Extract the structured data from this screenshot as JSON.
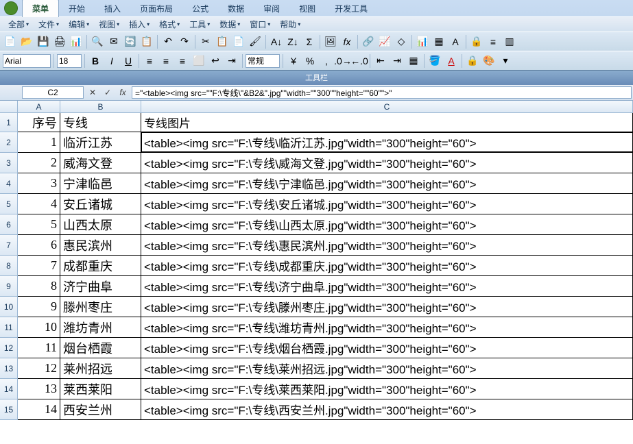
{
  "tabs": {
    "menu": "菜单",
    "start": "开始",
    "insert": "插入",
    "layout": "页面布局",
    "formula": "公式",
    "data": "数据",
    "review": "审阅",
    "view": "视图",
    "dev": "开发工具"
  },
  "menu": {
    "all": "全部",
    "file": "文件",
    "edit": "编辑",
    "view": "视图",
    "insert": "插入",
    "format": "格式",
    "tools": "工具",
    "data": "数据",
    "window": "窗口",
    "help": "帮助"
  },
  "toolbar": {
    "font": "Arial",
    "size": "18",
    "style_normal": "常规",
    "label": "工具栏"
  },
  "formula_bar": {
    "name_box": "C2",
    "fx": "fx",
    "formula": "=\"<table><img src=\"\"F:\\专线\\\"&B2&\".jpg\"\"width=\"\"300\"\"height=\"\"60\"\">\""
  },
  "columns": {
    "A": "A",
    "B": "B",
    "C": "C"
  },
  "header_row": {
    "seq": "序号",
    "line": "专线",
    "pic": "专线图片"
  },
  "rows": [
    {
      "n": "1",
      "seq": "1",
      "line": "临沂江苏",
      "pic": "<table><img src=\"F:\\专线\\临沂江苏.jpg\"width=\"300\"height=\"60\">"
    },
    {
      "n": "2",
      "seq": "2",
      "line": "威海文登",
      "pic": "<table><img src=\"F:\\专线\\威海文登.jpg\"width=\"300\"height=\"60\">"
    },
    {
      "n": "3",
      "seq": "3",
      "line": "宁津临邑",
      "pic": "<table><img src=\"F:\\专线\\宁津临邑.jpg\"width=\"300\"height=\"60\">"
    },
    {
      "n": "4",
      "seq": "4",
      "line": "安丘诸城",
      "pic": "<table><img src=\"F:\\专线\\安丘诸城.jpg\"width=\"300\"height=\"60\">"
    },
    {
      "n": "5",
      "seq": "5",
      "line": "山西太原",
      "pic": "<table><img src=\"F:\\专线\\山西太原.jpg\"width=\"300\"height=\"60\">"
    },
    {
      "n": "6",
      "seq": "6",
      "line": "惠民滨州",
      "pic": "<table><img src=\"F:\\专线\\惠民滨州.jpg\"width=\"300\"height=\"60\">"
    },
    {
      "n": "7",
      "seq": "7",
      "line": "成都重庆",
      "pic": "<table><img src=\"F:\\专线\\成都重庆.jpg\"width=\"300\"height=\"60\">"
    },
    {
      "n": "8",
      "seq": "8",
      "line": "济宁曲阜",
      "pic": "<table><img src=\"F:\\专线\\济宁曲阜.jpg\"width=\"300\"height=\"60\">"
    },
    {
      "n": "9",
      "seq": "9",
      "line": "滕州枣庄",
      "pic": "<table><img src=\"F:\\专线\\滕州枣庄.jpg\"width=\"300\"height=\"60\">"
    },
    {
      "n": "10",
      "seq": "10",
      "line": "潍坊青州",
      "pic": "<table><img src=\"F:\\专线\\潍坊青州.jpg\"width=\"300\"height=\"60\">"
    },
    {
      "n": "11",
      "seq": "11",
      "line": "烟台栖霞",
      "pic": "<table><img src=\"F:\\专线\\烟台栖霞.jpg\"width=\"300\"height=\"60\">"
    },
    {
      "n": "12",
      "seq": "12",
      "line": "莱州招远",
      "pic": "<table><img src=\"F:\\专线\\莱州招远.jpg\"width=\"300\"height=\"60\">"
    },
    {
      "n": "13",
      "seq": "13",
      "line": "莱西莱阳",
      "pic": "<table><img src=\"F:\\专线\\莱西莱阳.jpg\"width=\"300\"height=\"60\">"
    },
    {
      "n": "14",
      "seq": "14",
      "line": "西安兰州",
      "pic": "<table><img src=\"F:\\专线\\西安兰州.jpg\"width=\"300\"height=\"60\">"
    }
  ],
  "row_header_first": "1",
  "row_numbers": [
    "2",
    "3",
    "4",
    "5",
    "6",
    "7",
    "8",
    "9",
    "10",
    "11",
    "12",
    "13",
    "14",
    "15"
  ]
}
